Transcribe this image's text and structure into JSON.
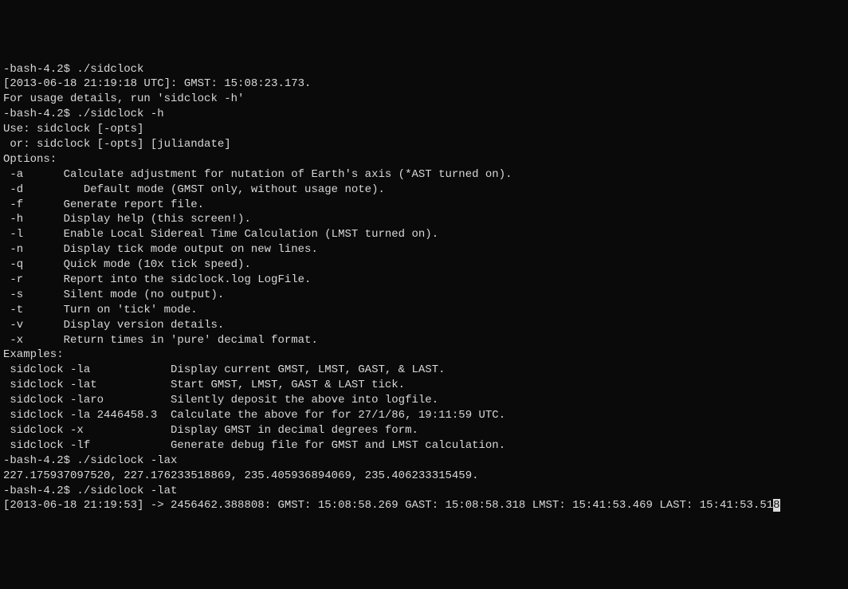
{
  "prompt1": "-bash-4.2$ ./sidclock",
  "output1_line1": "[2013-06-18 21:19:18 UTC]: GMST: 15:08:23.173.",
  "output1_line2": "For usage details, run 'sidclock -h'",
  "prompt2": "-bash-4.2$ ./sidclock -h",
  "help_use1": "Use: sidclock [-opts]",
  "help_use2": " or: sidclock [-opts] [juliandate]",
  "help_options_header": "Options:",
  "opt_a": " -a      Calculate adjustment for nutation of Earth's axis (*AST turned on).",
  "opt_d": " -d         Default mode (GMST only, without usage note).",
  "opt_f": " -f      Generate report file.",
  "opt_h": " -h      Display help (this screen!).",
  "opt_l": " -l      Enable Local Sidereal Time Calculation (LMST turned on).",
  "opt_n": " -n      Display tick mode output on new lines.",
  "opt_q": " -q      Quick mode (10x tick speed).",
  "opt_r": " -r      Report into the sidclock.log LogFile.",
  "opt_s": " -s      Silent mode (no output).",
  "opt_t": " -t      Turn on 'tick' mode.",
  "opt_v": " -v      Display version details.",
  "opt_x": " -x      Return times in 'pure' decimal format.",
  "help_examples_header": "Examples:",
  "ex1": " sidclock -la            Display current GMST, LMST, GAST, & LAST.",
  "ex2": " sidclock -lat           Start GMST, LMST, GAST & LAST tick.",
  "ex3": " sidclock -laro          Silently deposit the above into logfile.",
  "ex4": " sidclock -la 2446458.3  Calculate the above for for 27/1/86, 19:11:59 UTC.",
  "ex5": " sidclock -x             Display GMST in decimal degrees form.",
  "ex6": " sidclock -lf            Generate debug file for GMST and LMST calculation.",
  "prompt3": "-bash-4.2$ ./sidclock -lax",
  "output3": "227.175937097520, 227.176233518869, 235.405936894069, 235.406233315459.",
  "prompt4": "-bash-4.2$ ./sidclock -lat",
  "output4_prefix": "[2013-06-18 21:19:53] -> 2456462.388808: GMST: 15:08:58.269 GAST: 15:08:58.318 LMST: 15:41:53.469 LAST: 15:41:53.51",
  "output4_highlight": "8"
}
